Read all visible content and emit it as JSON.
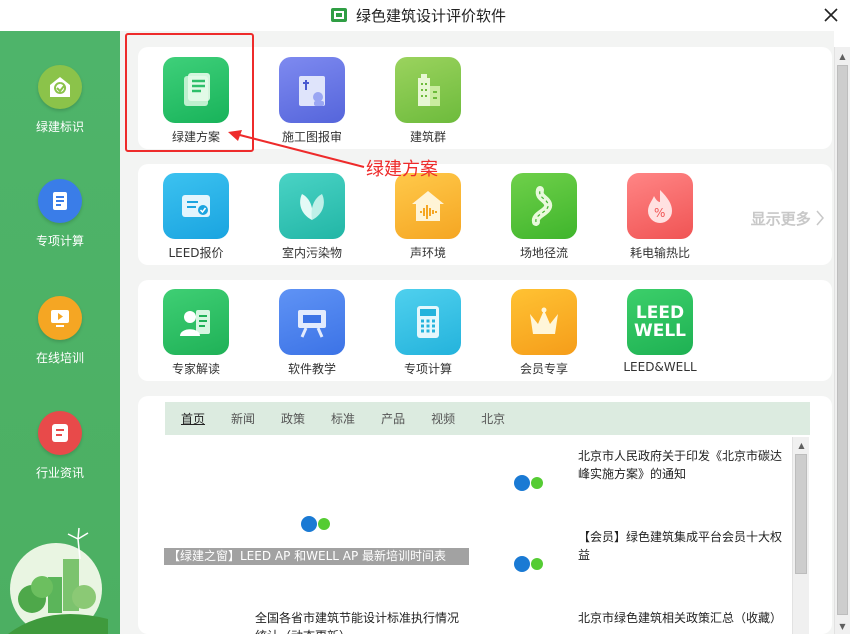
{
  "window": {
    "title": "绿色建筑设计评价软件"
  },
  "sidebar": {
    "items": [
      {
        "label": "绿建标识",
        "icon": "leaf-house-icon",
        "color": "#8bc34a"
      },
      {
        "label": "专项计算",
        "icon": "document-icon",
        "color": "#3a7de8"
      },
      {
        "label": "在线培训",
        "icon": "video-icon",
        "color": "#f5a623"
      },
      {
        "label": "行业资讯",
        "icon": "news-icon",
        "color": "#e84a4a"
      }
    ]
  },
  "panels": {
    "row1": [
      {
        "label": "绿建方案",
        "icon": "green-doc-icon"
      },
      {
        "label": "施工图报审",
        "icon": "blueprint-icon"
      },
      {
        "label": "建筑群",
        "icon": "buildings-icon"
      }
    ],
    "row2": [
      {
        "label": "LEED报价",
        "icon": "card-icon"
      },
      {
        "label": "室内污染物",
        "icon": "leaves-icon"
      },
      {
        "label": "声环境",
        "icon": "sound-house-icon"
      },
      {
        "label": "场地径流",
        "icon": "road-icon"
      },
      {
        "label": "耗电输热比",
        "icon": "flame-percent-icon"
      }
    ],
    "row3": [
      {
        "label": "专家解读",
        "icon": "expert-icon"
      },
      {
        "label": "软件教学",
        "icon": "board-icon"
      },
      {
        "label": "专项计算",
        "icon": "calculator-icon"
      },
      {
        "label": "会员专享",
        "icon": "crown-icon"
      },
      {
        "label": "LEED&WELL",
        "icon": "leed-well-icon"
      }
    ],
    "show_more": "显示更多",
    "leed_line1": "LEED",
    "leed_line2": "WELL"
  },
  "annotation": {
    "text": "绿建方案",
    "color": "#ee2b2b"
  },
  "news": {
    "tabs": [
      "首页",
      "新闻",
      "政策",
      "标准",
      "产品",
      "视频",
      "北京"
    ],
    "left": {
      "caption": "【绿建之窗】LEED AP 和WELL AP 最新培训时间表",
      "title": "全国各省市建筑节能设计标准执行情况统计（动态更新）"
    },
    "right": [
      {
        "title": "北京市人民政府关于印发《北京市碳达峰实施方案》的通知"
      },
      {
        "title": "【会员】绿色建筑集成平台会员十大权益"
      },
      {
        "title": "北京市绿色建筑相关政策汇总（收藏）"
      }
    ]
  },
  "colors": {
    "sidebar": "#4eb46a",
    "accent_blue": "#1a7ad4",
    "accent_green": "#55cc33"
  }
}
